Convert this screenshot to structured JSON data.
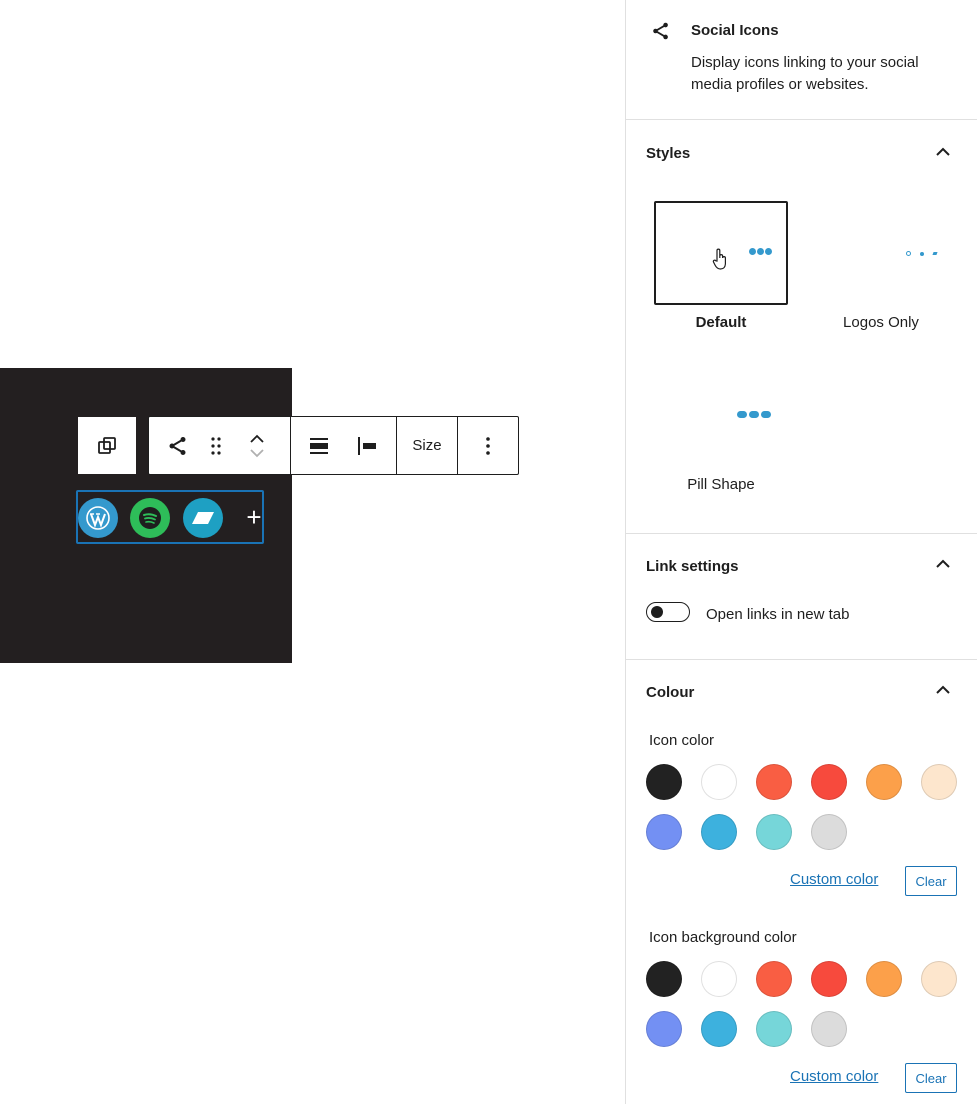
{
  "toolbar": {
    "size_label": "Size"
  },
  "social_icons": {
    "items": [
      {
        "icon": "wordpress-icon",
        "color": "#3499cd"
      },
      {
        "icon": "spotify-icon",
        "color": "#2ebd59"
      },
      {
        "icon": "bandcamp-icon",
        "color": "#1ea0c3"
      }
    ],
    "add_glyph": "+"
  },
  "block_card": {
    "title": "Social Icons",
    "description": "Display icons linking to your social media profiles or websites."
  },
  "styles": {
    "title": "Styles",
    "options": [
      {
        "label": "Default",
        "selected": true
      },
      {
        "label": "Logos Only",
        "selected": false
      },
      {
        "label": "Pill Shape",
        "selected": false
      }
    ]
  },
  "link_settings": {
    "title": "Link settings",
    "open_new_tab_label": "Open links in new tab",
    "open_new_tab": false
  },
  "colour": {
    "title": "Colour",
    "icon_color_label": "Icon color",
    "icon_bg_color_label": "Icon background color",
    "custom_color_label": "Custom color",
    "clear_label": "Clear",
    "palette": [
      "#222222",
      "#ffffff",
      "#f95e43",
      "#f74a3d",
      "#fca04a",
      "#fde6cd",
      "#7390f3",
      "#3db1de",
      "#76d6d9",
      "#dcdcdc"
    ]
  },
  "colors": {
    "accent": "#1a73b5",
    "canvas_dark": "#231f20"
  }
}
